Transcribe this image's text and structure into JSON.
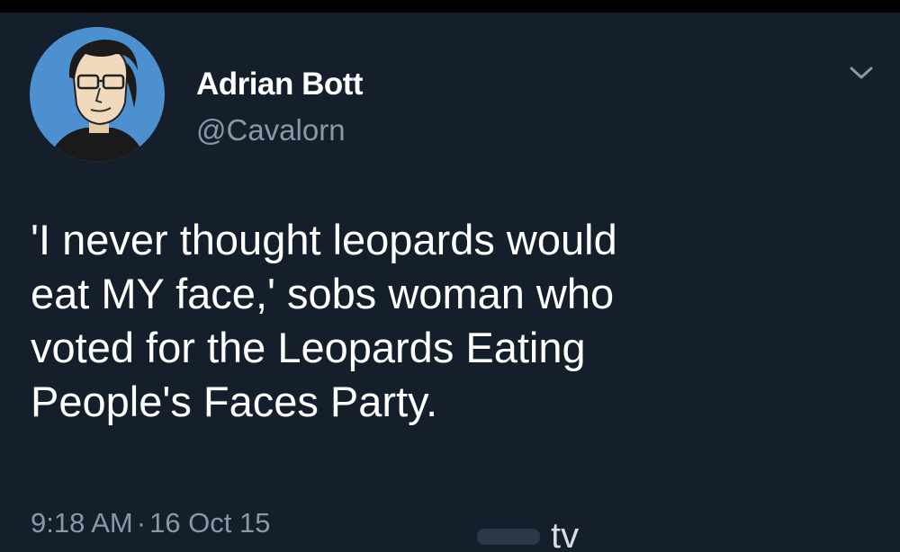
{
  "tweet": {
    "author_name": "Adrian Bott",
    "author_handle": "@Cavalorn",
    "text_lines": [
      "'I never thought leopards would",
      "eat MY face,' sobs woman who",
      "voted for the Leopards Eating",
      "People's Faces Party."
    ],
    "time": "9:18 AM",
    "separator": "·",
    "date": "16 Oct 15",
    "menu_icon": "chevron-down-icon",
    "avatar_icon": "cartoon-avatar"
  },
  "watermark": {
    "text": "tv"
  },
  "colors": {
    "background": "#151f2b",
    "primary_text": "#ffffff",
    "secondary_text": "#8899a6",
    "avatar_bg": "#4d90d0"
  }
}
